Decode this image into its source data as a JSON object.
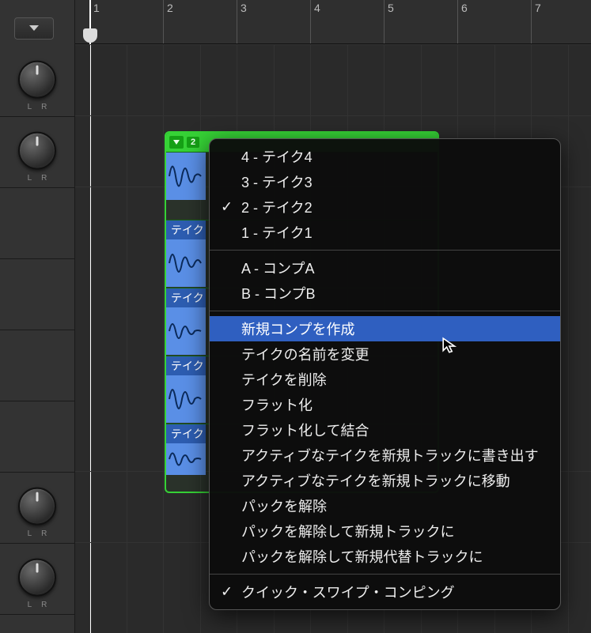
{
  "ruler": {
    "labels": [
      "1",
      "2",
      "3",
      "4",
      "5",
      "6",
      "7"
    ]
  },
  "pan": {
    "l": "L",
    "r": "R"
  },
  "take_folder": {
    "badge": "2",
    "lanes": [
      {
        "label": ""
      },
      {
        "label": "テイク"
      },
      {
        "label": "テイク"
      },
      {
        "label": "テイク"
      },
      {
        "label": "テイク"
      }
    ]
  },
  "menu": {
    "takes": [
      {
        "label": "4 - テイク4",
        "checked": false
      },
      {
        "label": "3 - テイク3",
        "checked": false
      },
      {
        "label": "2 - テイク2",
        "checked": true
      },
      {
        "label": "1 - テイク1",
        "checked": false
      }
    ],
    "comps": [
      {
        "label": "A - コンプA"
      },
      {
        "label": "B - コンプB"
      }
    ],
    "actions": [
      {
        "label": "新規コンプを作成",
        "highlight": true
      },
      {
        "label": "テイクの名前を変更"
      },
      {
        "label": "テイクを削除"
      },
      {
        "label": "フラット化"
      },
      {
        "label": "フラット化して結合"
      },
      {
        "label": "アクティブなテイクを新規トラックに書き出す"
      },
      {
        "label": "アクティブなテイクを新規トラックに移動"
      },
      {
        "label": "パックを解除"
      },
      {
        "label": "パックを解除して新規トラックに"
      },
      {
        "label": "パックを解除して新規代替トラックに"
      }
    ],
    "footer": {
      "label": "クイック・スワイプ・コンピング",
      "checked": true
    }
  }
}
